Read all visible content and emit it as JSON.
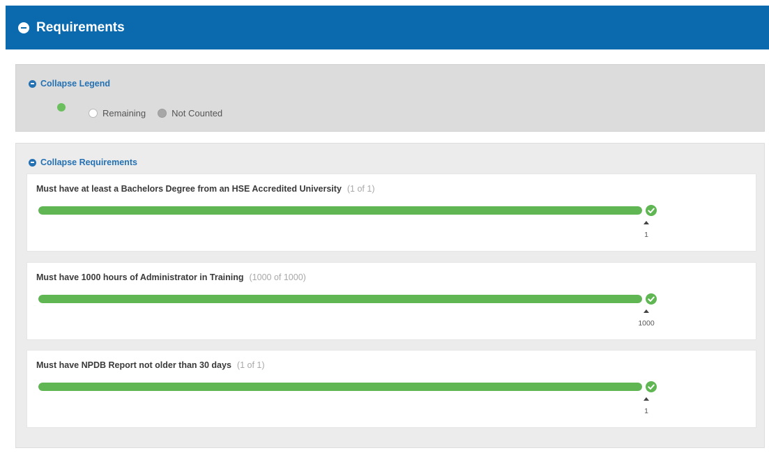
{
  "header": {
    "title": "Requirements",
    "icon": "collapse-minus-icon",
    "color": "#0a6aad"
  },
  "legend": {
    "toggle_label": "Collapse Legend",
    "items": [
      {
        "label": "",
        "status": "met",
        "color": "#6cbf5e"
      },
      {
        "label": "Remaining",
        "status": "remaining",
        "color": "#ffffff"
      },
      {
        "label": "Not Counted",
        "status": "not-counted",
        "color": "#a7a7a7"
      }
    ]
  },
  "requirements": {
    "toggle_label": "Collapse Requirements",
    "items": [
      {
        "title": "Must have at least a Bachelors Degree from an HSE Accredited University",
        "count": "(1 of 1)",
        "progress": 1.0,
        "marker_value": "1",
        "status_icon": "check-circle-icon"
      },
      {
        "title": "Must have 1000 hours of Administrator in Training",
        "count": "(1000 of 1000)",
        "progress": 1.0,
        "marker_value": "1000",
        "status_icon": "check-circle-icon"
      },
      {
        "title": "Must have NPDB Report not older than 30 days",
        "count": "(1 of 1)",
        "progress": 1.0,
        "marker_value": "1",
        "status_icon": "check-circle-icon"
      }
    ]
  },
  "colors": {
    "progress_fill": "#5fb653",
    "link": "#2471b3"
  }
}
